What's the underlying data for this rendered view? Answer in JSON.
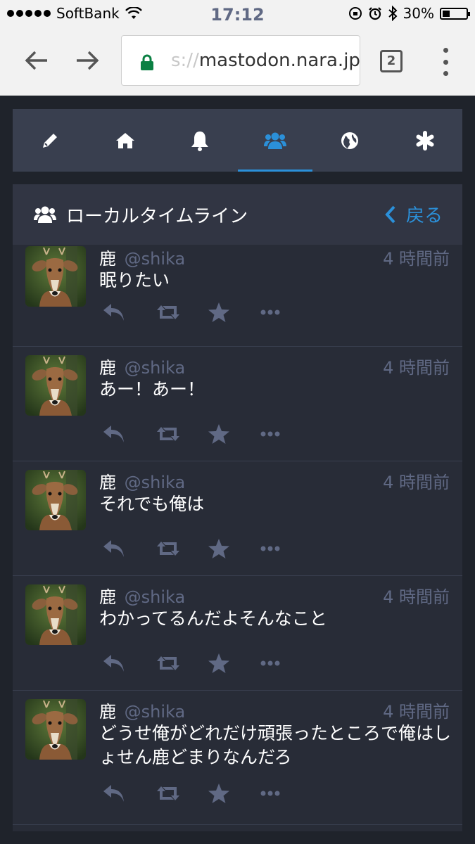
{
  "statusbar": {
    "carrier": "SoftBank",
    "time": "17:12",
    "battery": "30%",
    "battery_level": 0.3
  },
  "browser": {
    "url_scheme_fragment": "s://",
    "url_host": "mastodon.nara.jp",
    "tab_count": "2"
  },
  "colors": {
    "accent": "#2b90d9",
    "nav_bg": "#393f4f",
    "column_bg": "#282c37",
    "muted": "#606984"
  },
  "nav": {
    "tabs": [
      {
        "icon": "pencil-icon"
      },
      {
        "icon": "home-icon"
      },
      {
        "icon": "bell-icon"
      },
      {
        "icon": "users-icon",
        "active": true
      },
      {
        "icon": "globe-icon"
      },
      {
        "icon": "asterisk-icon"
      }
    ]
  },
  "column": {
    "title": "ローカルタイムライン",
    "back_label": "戻る"
  },
  "statuses": [
    {
      "display_name": "鹿",
      "acct": "@shika",
      "time": "4 時間前",
      "content": "眠りたい"
    },
    {
      "display_name": "鹿",
      "acct": "@shika",
      "time": "4 時間前",
      "content": "あー！あー！"
    },
    {
      "display_name": "鹿",
      "acct": "@shika",
      "time": "4 時間前",
      "content": "それでも俺は"
    },
    {
      "display_name": "鹿",
      "acct": "@shika",
      "time": "4 時間前",
      "content": "わかってるんだよそんなこと"
    },
    {
      "display_name": "鹿",
      "acct": "@shika",
      "time": "4 時間前",
      "content": "どうせ俺がどれだけ頑張ったところで俺はしょせん鹿どまりなんだろ"
    }
  ]
}
